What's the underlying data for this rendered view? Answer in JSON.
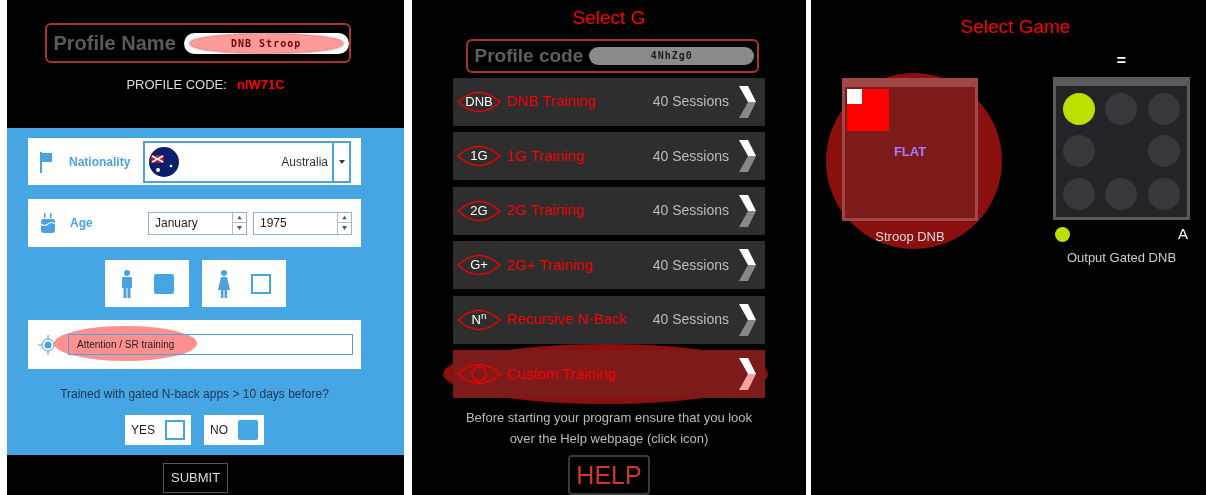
{
  "profile_panel": {
    "profile_name": {
      "label": "Profile Name",
      "value": "DNB Stroop",
      "highlighted": true
    },
    "profile_code": {
      "label": "PROFILE CODE:",
      "value": "nIW71C"
    },
    "nationality": {
      "label": "Nationality",
      "value": "Australia"
    },
    "age": {
      "label": "Age",
      "month": "January",
      "year": "1975"
    },
    "gender": [
      {
        "kind": "male",
        "checked": true
      },
      {
        "kind": "female",
        "checked": false
      }
    ],
    "goal": {
      "value": "Attention / SR training",
      "highlighted": true
    },
    "question": "Trained with gated N-back apps > 10 days before?",
    "answers": [
      {
        "label": "YES",
        "checked": false
      },
      {
        "label": "NO",
        "checked": true
      }
    ],
    "submit": "SUBMIT"
  },
  "program_panel": {
    "title": "Select G",
    "profile_code": {
      "label": "Profile code",
      "value": "4NhZg0"
    },
    "programs": [
      {
        "badge": "DNB",
        "name": "DNB Training",
        "sessions": "40 Sessions",
        "highlighted": false
      },
      {
        "badge": "1G",
        "name": "1G Training",
        "sessions": "40 Sessions",
        "highlighted": false
      },
      {
        "badge": "2G",
        "name": "2G Training",
        "sessions": "40 Sessions",
        "highlighted": false
      },
      {
        "badge": "G+",
        "name": "2G+ Training",
        "sessions": "40 Sessions",
        "highlighted": false
      },
      {
        "badge": "N$^{n}$",
        "name": "Recursive N-Back",
        "sessions": "40 Sessions",
        "highlighted": false
      },
      {
        "name": "Custom Training",
        "highlighted": true
      }
    ],
    "note": "Before starting your program ensure that you look over the Help webpage (click icon)",
    "help": "HELP"
  },
  "game_panel": {
    "title": "Select Game",
    "games": [
      {
        "kind": "stroop",
        "name": "Stroop DNB",
        "word": "FLAT",
        "highlighted": true
      },
      {
        "kind": "gated",
        "name": "Output Gated DNB",
        "header": "=",
        "letter": "A",
        "highlighted": false
      }
    ]
  }
}
